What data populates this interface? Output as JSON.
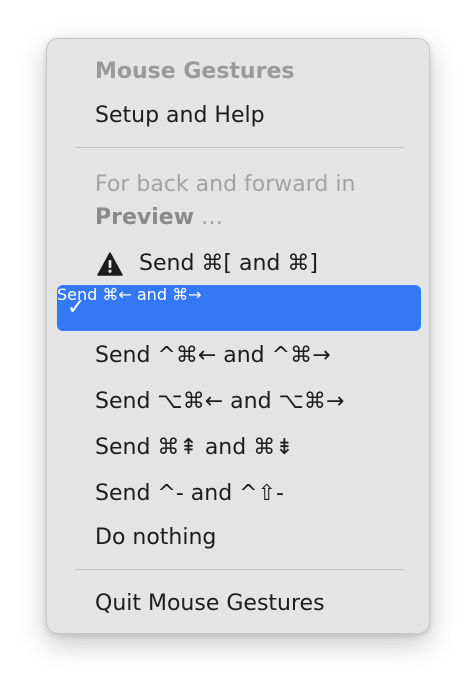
{
  "menu": {
    "header": "Mouse Gestures",
    "setup_help": "Setup and Help",
    "note_line1": "For back and forward in",
    "note_line2_bold": "Preview",
    "note_line2_rest": " …",
    "options": [
      {
        "label": "Send ⌘[ and ⌘]",
        "icon": "warning-icon",
        "selected": false
      },
      {
        "label": "Send ⌘← and ⌘→",
        "icon": "checkmark-icon",
        "selected": true
      },
      {
        "label": "Send ^⌘← and ^⌘→",
        "selected": false
      },
      {
        "label": "Send ⌥⌘← and ⌥⌘→",
        "selected": false
      },
      {
        "label": "Send ⌘⇞ and ⌘⇟",
        "selected": false
      },
      {
        "label": "Send ^- and ^⇧-",
        "selected": false
      },
      {
        "label": "Do nothing",
        "selected": false
      }
    ],
    "check_glyph": "✓",
    "quit": "Quit Mouse Gestures",
    "colors": {
      "background": "#e4e4e4",
      "highlight": "#3478f6",
      "header_text": "#9a9a9a",
      "text": "#1d1d1d"
    }
  }
}
